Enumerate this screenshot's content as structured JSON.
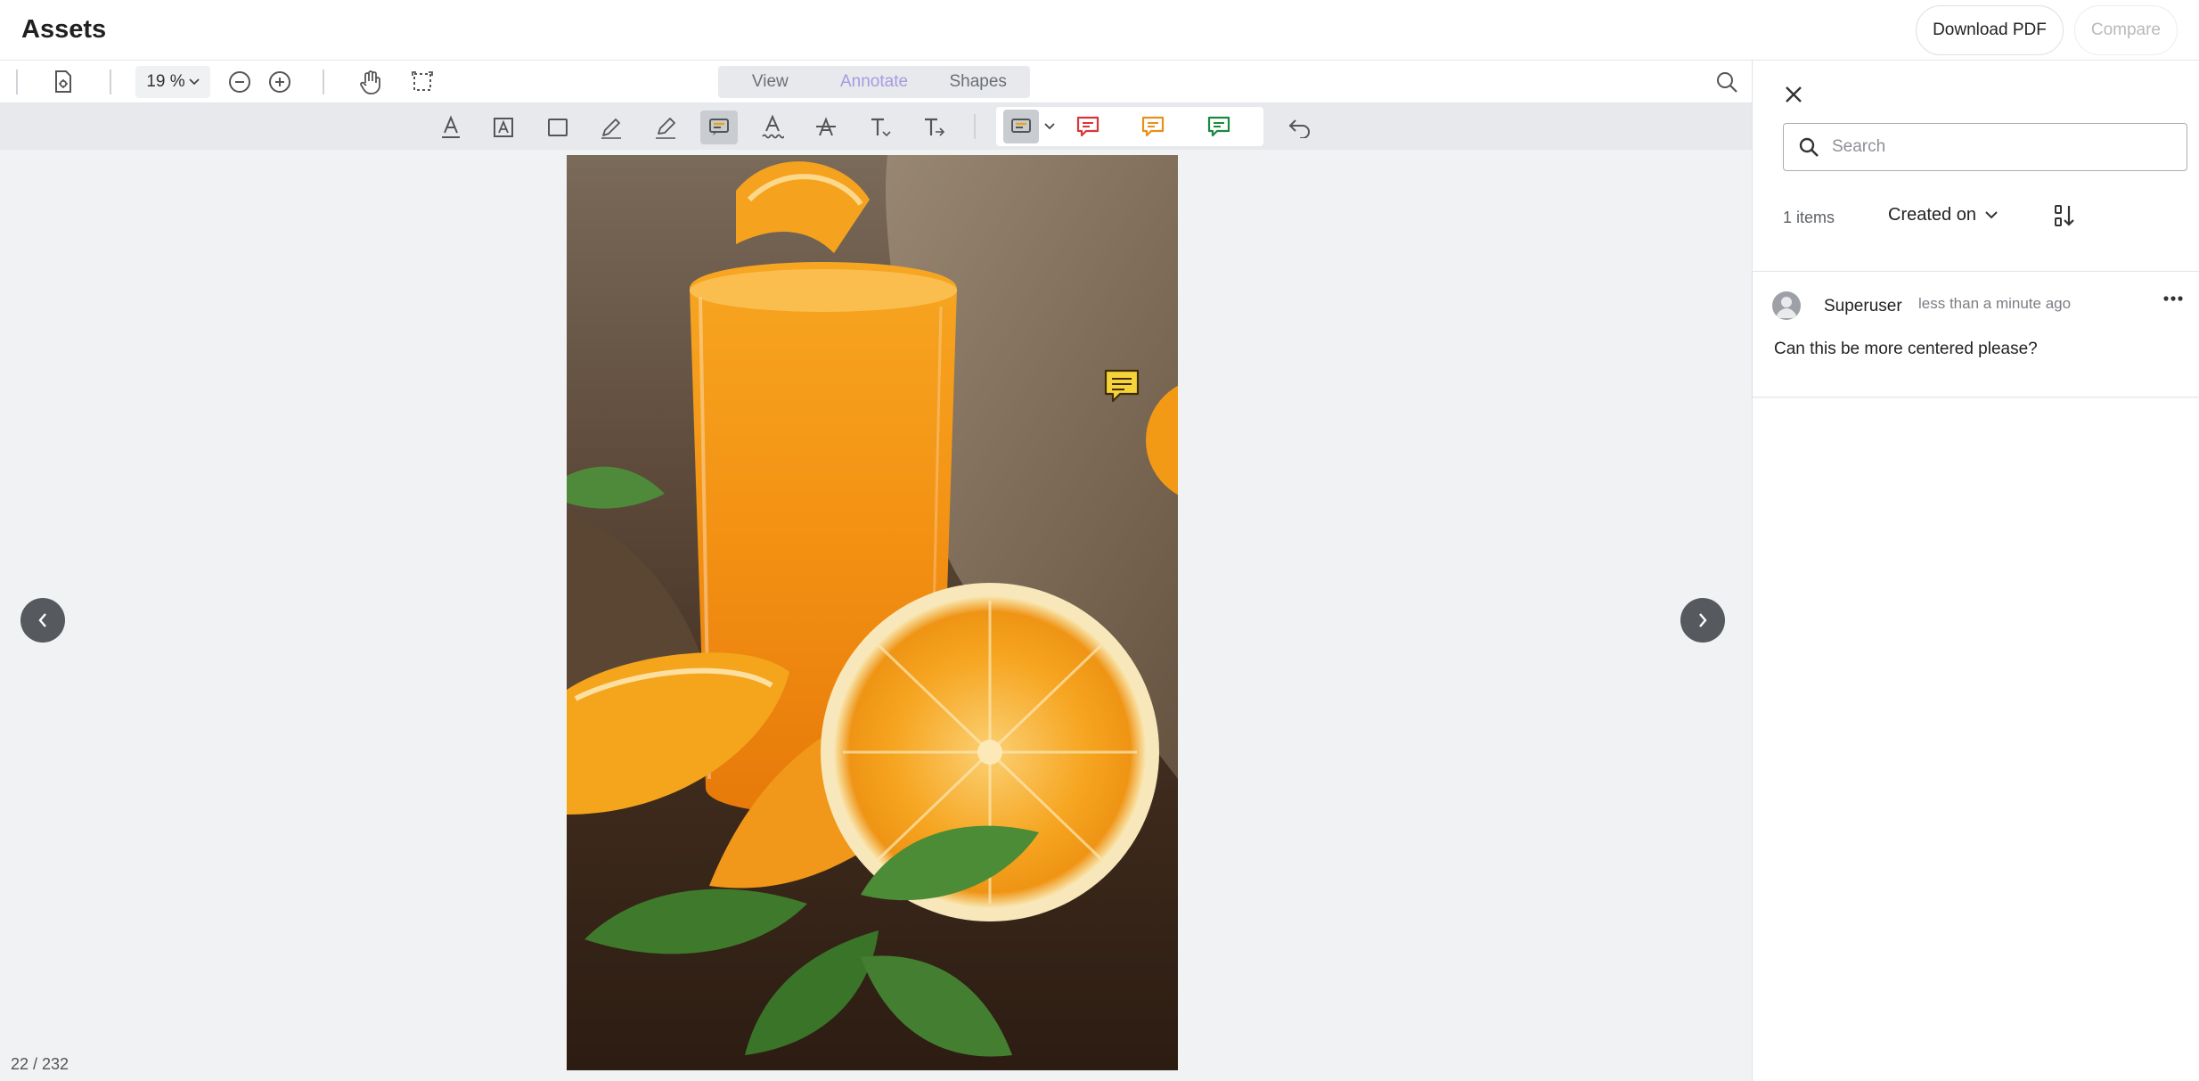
{
  "header": {
    "title": "Assets",
    "download_label": "Download PDF",
    "compare_label": "Compare"
  },
  "toolbar": {
    "zoom": "19 %",
    "tabs": [
      {
        "label": "View",
        "active": false
      },
      {
        "label": "Annotate",
        "active": true
      },
      {
        "label": "Shapes",
        "active": false
      }
    ],
    "icons_left": [
      "page-settings-icon",
      "zoom-out-icon",
      "zoom-in-icon",
      "pan-hand-icon",
      "marquee-select-icon"
    ],
    "icons_right": [
      "search-icon"
    ]
  },
  "annotate_tools": {
    "icons": [
      "text-color-icon",
      "text-box-icon",
      "rectangle-icon",
      "pen-icon",
      "highlighter-icon",
      "sticky-note-icon",
      "squiggly-underline-icon",
      "strikeout-icon",
      "insert-text-icon",
      "replace-text-icon"
    ],
    "selected": "sticky-note-icon",
    "note_colors": [
      "#e5a90e",
      "#d93636",
      "#e8901a",
      "#198a3f"
    ],
    "undo": "undo-icon"
  },
  "pager": {
    "current": "22 / 232"
  },
  "comments_panel": {
    "search_placeholder": "Search",
    "items_count": "1 items",
    "sort_by": "Created on",
    "comments": [
      {
        "author": "Superuser",
        "time": "less than a minute ago",
        "text": "Can this be more centered please?"
      }
    ]
  },
  "colors": {
    "accent_purple": "#a99ae0",
    "note_yellow": "#f7d33b",
    "nav_button": "#565a5f"
  }
}
